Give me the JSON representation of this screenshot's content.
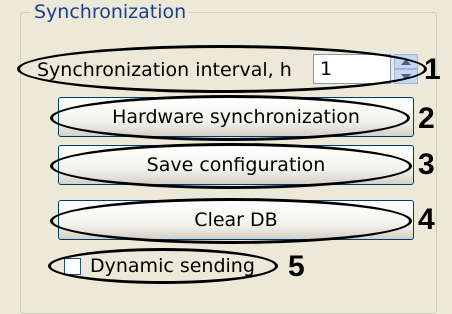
{
  "group": {
    "title": "Synchronization"
  },
  "interval": {
    "label": "Synchronization interval, h",
    "value": "1"
  },
  "buttons": {
    "hardware_sync": "Hardware synchronization",
    "save_config": "Save configuration",
    "clear_db": "Clear DB"
  },
  "dynamic_sending": {
    "label": "Dynamic sending",
    "checked": false
  },
  "callouts": [
    "1",
    "2",
    "3",
    "4",
    "5"
  ],
  "colors": {
    "background": "#ece9d8",
    "group_title": "#1b3f8f",
    "button_border": "#003c74",
    "annotation": "#000000"
  }
}
